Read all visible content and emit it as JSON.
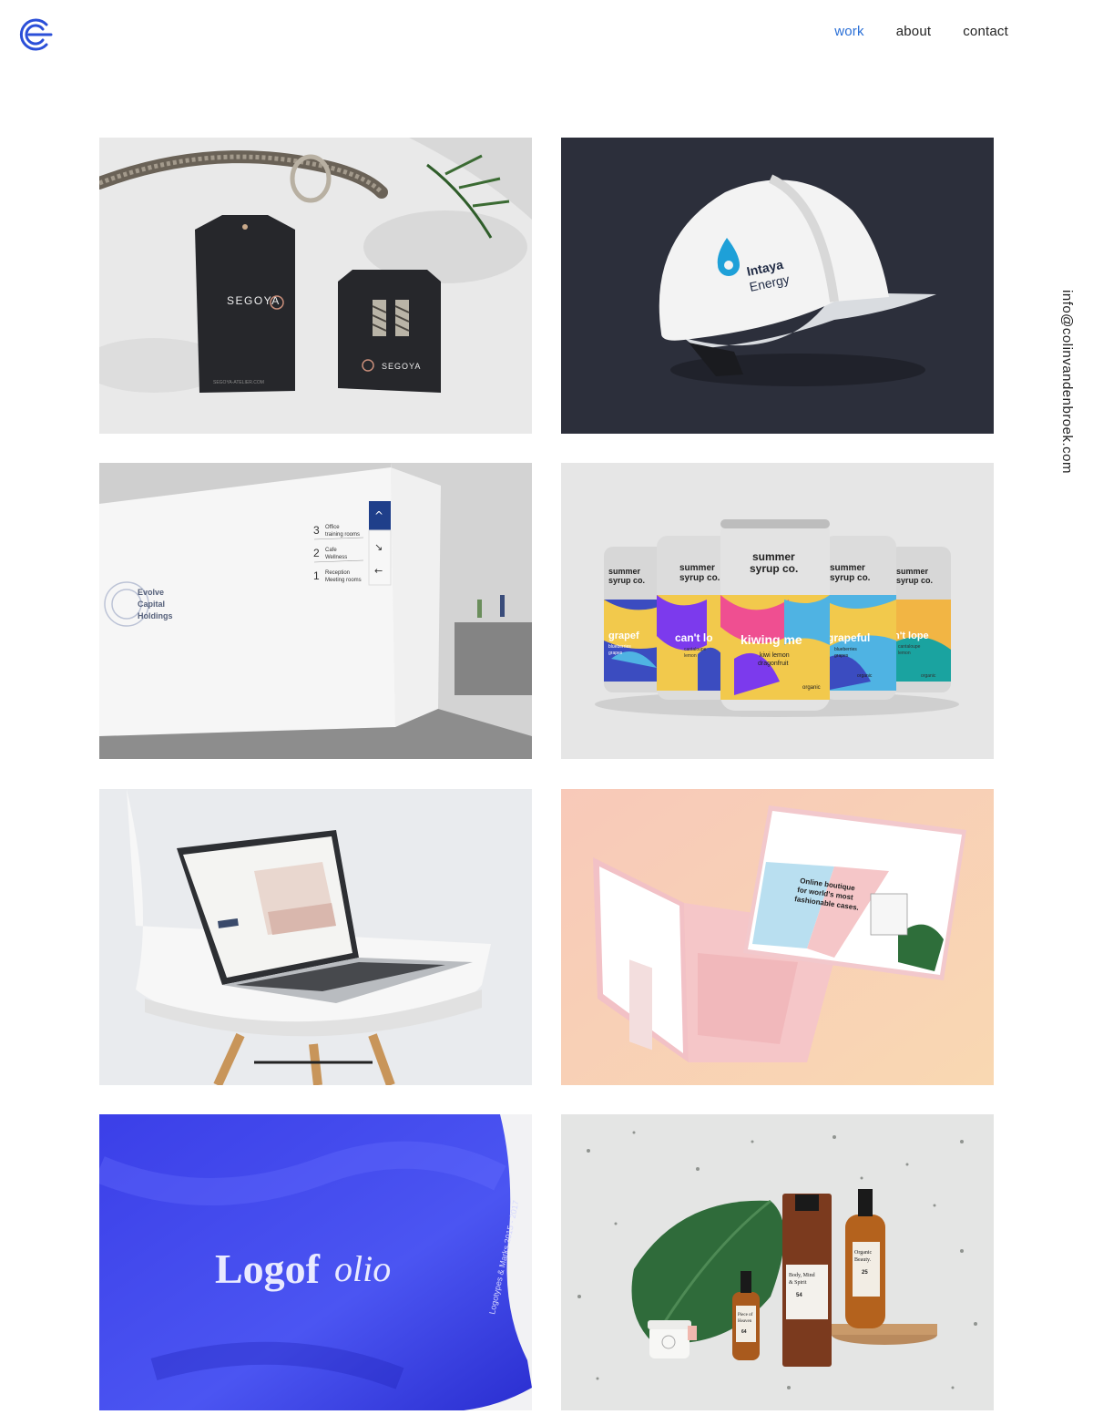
{
  "header": {
    "nav": [
      {
        "label": "work",
        "active": true
      },
      {
        "label": "about",
        "active": false
      },
      {
        "label": "contact",
        "active": false
      }
    ]
  },
  "side_email": "info@colinvandenbroek.com",
  "colors": {
    "accent": "#2a6fd6",
    "text": "#222222",
    "logo": "#2b4fd8"
  },
  "projects": {
    "segoya": {
      "brand": "SEGOYA",
      "url": "SEGOYA-ATELIER.COM"
    },
    "intaya": {
      "line1": "Intaya",
      "line2": "Energy"
    },
    "evolve": {
      "name": [
        "Evolve",
        "Capital",
        "Holdings"
      ],
      "floors": [
        {
          "num": "3",
          "line1": "Office",
          "line2": "training rooms"
        },
        {
          "num": "2",
          "line1": "Cafe",
          "line2": "Wellness"
        },
        {
          "num": "1",
          "line1": "Reception",
          "line2": "Meeting rooms"
        }
      ]
    },
    "summer": {
      "brand_line1": "summer",
      "brand_line2": "syrup co.",
      "cans": [
        {
          "flavor": "grapef",
          "sub1": "blueberries",
          "sub2": "grapes"
        },
        {
          "flavor": "can't lo",
          "sub1": "cantaloupe",
          "sub2": "lemon"
        },
        {
          "flavor": "kiwing me",
          "sub1": "kiwi lemon",
          "sub2": "dragonfruit",
          "note": "organic"
        },
        {
          "flavor": "grapeful",
          "sub1": "blueberries",
          "sub2": "grapes",
          "note": "organic"
        },
        {
          "flavor": "n't lope",
          "sub1": "cantaloupe",
          "sub2": "lemon",
          "note": "organic"
        }
      ]
    },
    "boutique": {
      "headline": [
        "Online boutique",
        "for world's most",
        "fashionable cases."
      ]
    },
    "logofolio": {
      "title_bold": "Logof",
      "title_italic": "olio",
      "caption": "Logotypes & Marks 2015 - 2017"
    },
    "cosmetics": {
      "bottle1": [
        "Body, Mind",
        "& Spirit"
      ],
      "bottle1_num": "54",
      "bottle2": [
        "Organic",
        "Beauty."
      ],
      "bottle2_num": "25",
      "dropper": [
        "Piece of",
        "Heaven"
      ],
      "dropper_num": "64"
    }
  }
}
